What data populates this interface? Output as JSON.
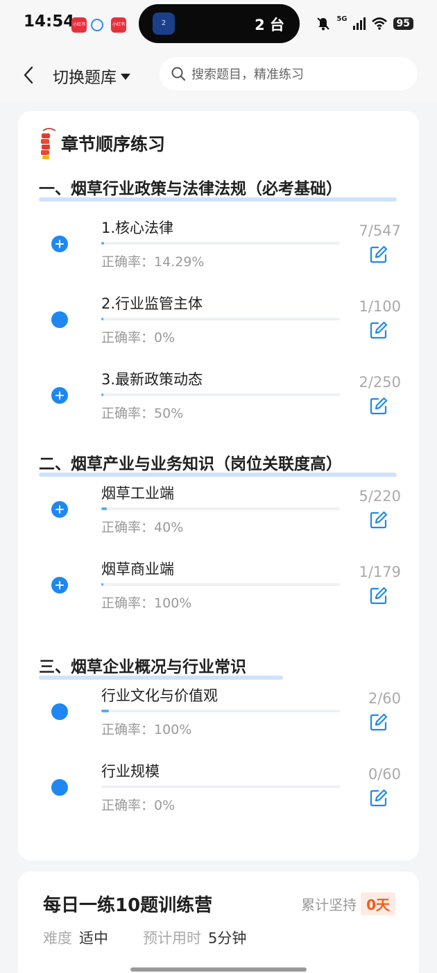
{
  "status_bar": {
    "time": "14:54",
    "app_badges": [
      "小红书",
      "",
      "小红书"
    ],
    "island_icon": "2",
    "island_text": "2 台",
    "network": "5G",
    "battery": "95"
  },
  "header": {
    "switch_label": "切换题库",
    "search_placeholder": "搜索题目，精准练习"
  },
  "practice": {
    "title": "章节顺序练习",
    "accuracy_label": "正确率：",
    "sections": [
      {
        "title": "一、烟草行业政策与法律法规（必考基础）",
        "items": [
          {
            "name": "1.核心法律",
            "accuracy": "14.29%",
            "count": "7/547",
            "icon": "plus",
            "progress": 0.013
          },
          {
            "name": "2.行业监管主体",
            "accuracy": "0%",
            "count": "1/100",
            "icon": "dot",
            "progress": 0.01
          },
          {
            "name": "3.最新政策动态",
            "accuracy": "50%",
            "count": "2/250",
            "icon": "plus",
            "progress": 0.008
          }
        ]
      },
      {
        "title": "二、烟草产业与业务知识（岗位关联度高）",
        "items": [
          {
            "name": "烟草工业端",
            "accuracy": "40%",
            "count": "5/220",
            "icon": "plus",
            "progress": 0.023
          },
          {
            "name": "烟草商业端",
            "accuracy": "100%",
            "count": "1/179",
            "icon": "plus",
            "progress": 0.006
          }
        ]
      },
      {
        "title": "三、烟草企业概况与行业常识",
        "items": [
          {
            "name": "行业文化与价值观",
            "accuracy": "100%",
            "count": "2/60",
            "icon": "dot",
            "progress": 0.033
          },
          {
            "name": "行业规模",
            "accuracy": "0%",
            "count": "0/60",
            "icon": "dot",
            "progress": 0
          }
        ]
      }
    ]
  },
  "daily": {
    "title": "每日一练10题训练营",
    "streak_label": "累计坚持",
    "streak_value": "0天",
    "difficulty_label": "难度",
    "difficulty_value": "适中",
    "time_label": "预计用时",
    "time_value": "5分钟"
  },
  "colors": {
    "accent": "#1e88f0",
    "progress": "#56aee8",
    "highlight": "#cfe2fb",
    "streak": "#f25c1c"
  }
}
